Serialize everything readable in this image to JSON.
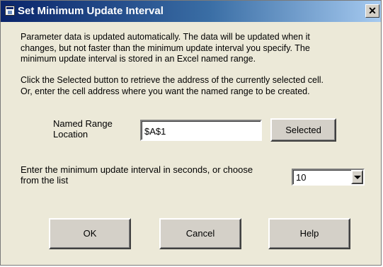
{
  "window": {
    "title": "Set Minimum Update Interval",
    "close_label": "✕"
  },
  "description": {
    "line1": "Parameter data is updated automatically.  The data will be updated when it",
    "line2": "changes, but not faster than the minimum update interval you specify.  The",
    "line3": "minimum update interval is stored in an Excel named range.",
    "line4": "Click the Selected button to retrieve the address of the currently selected cell.",
    "line5": "Or, enter the cell address where you want the named range to be created."
  },
  "named_range": {
    "label_line1": "Named Range",
    "label_line2": "Location",
    "value": "$A$1",
    "selected_button": "Selected"
  },
  "interval": {
    "label_line1": "Enter the minimum update interval in seconds, or choose",
    "label_line2": "from the list",
    "value": "10"
  },
  "buttons": {
    "ok": "OK",
    "cancel": "Cancel",
    "help": "Help"
  },
  "icons": {
    "app": "window-icon",
    "close": "close-icon",
    "dropdown": "chevron-down-icon"
  }
}
